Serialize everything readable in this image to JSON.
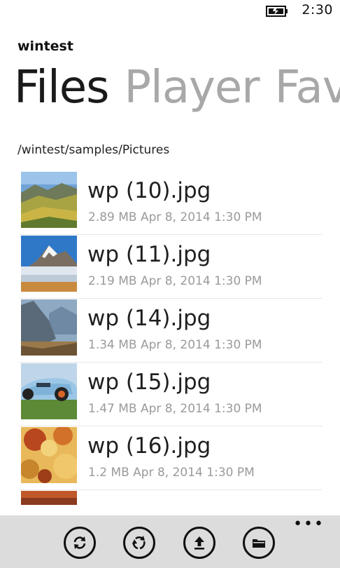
{
  "status_bar": {
    "time": "2:30"
  },
  "app": {
    "title": "wintest"
  },
  "pivot": {
    "tabs": [
      {
        "label": "Files",
        "active": true
      },
      {
        "label": "Player",
        "active": false
      },
      {
        "label": "Fav",
        "active": false
      }
    ]
  },
  "path": "/wintest/samples/Pictures",
  "files": [
    {
      "name": "wp (10).jpg",
      "meta": "2.89 MB Apr 8, 2014 1:30 PM",
      "thumb": "autumn-mountain-valley"
    },
    {
      "name": "wp (11).jpg",
      "meta": "2.19 MB Apr 8, 2014 1:30 PM",
      "thumb": "snowy-peak-lake"
    },
    {
      "name": "wp (14).jpg",
      "meta": "1.34 MB Apr 8, 2014 1:30 PM",
      "thumb": "misty-mountains"
    },
    {
      "name": "wp (15).jpg",
      "meta": "1.47 MB Apr 8, 2014 1:30 PM",
      "thumb": "blue-race-car"
    },
    {
      "name": "wp (16).jpg",
      "meta": "1.2 MB Apr 8, 2014 1:30 PM",
      "thumb": "autumn-leaves"
    }
  ],
  "app_bar": {
    "buttons": [
      {
        "icon": "sync-icon"
      },
      {
        "icon": "refresh-icon"
      },
      {
        "icon": "upload-icon"
      },
      {
        "icon": "folder-icon"
      }
    ],
    "more": "•••"
  },
  "colors": {
    "background": "#ffffff",
    "app_bar": "#dcdcdc",
    "pivot_inactive": "#a8a8a8",
    "meta_text": "#9a9a9a"
  }
}
